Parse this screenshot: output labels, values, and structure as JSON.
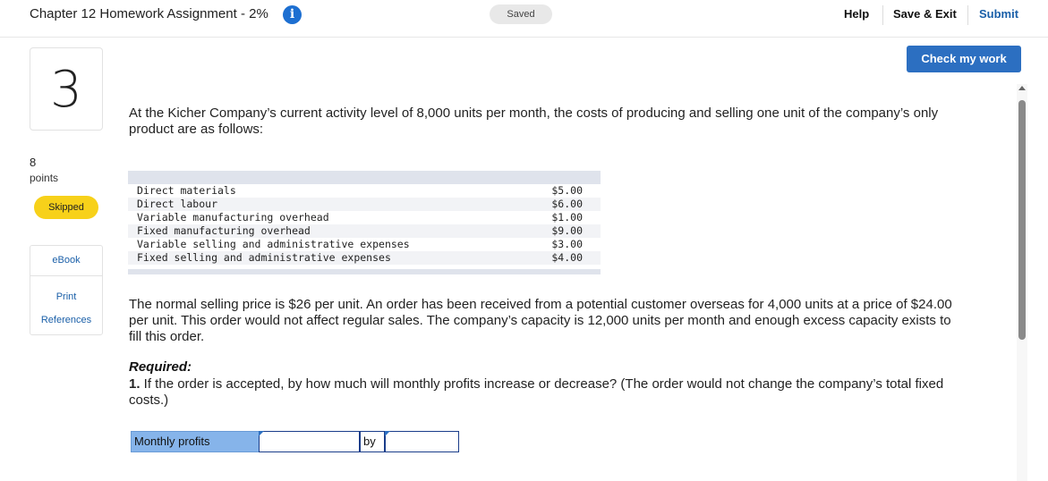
{
  "header": {
    "title": "Chapter 12 Homework Assignment - 2%",
    "info_icon": "info-icon",
    "saved_status": "Saved",
    "help_label": "Help",
    "save_exit_label": "Save & Exit",
    "submit_label": "Submit"
  },
  "question": {
    "number": "3",
    "points_value": "8",
    "points_label": "points",
    "status": "Skipped",
    "check_button": "Check my work",
    "intro": "At the Kicher Company’s current activity level of 8,000 units per month, the costs of producing and selling one unit of the company’s only product are as follows:",
    "details": "The normal selling price is $26 per unit. An order has been received from a potential customer overseas for 4,000 units at a price of $24.00 per unit. This order would not affect regular sales. The company’s capacity is 12,000 units per month and enough excess capacity exists to fill this order.",
    "required_heading": "Required:",
    "required_number": "1.",
    "required_text": " If the order is accepted, by how much will monthly profits increase or decrease? (The order would not change the company’s total fixed costs.)"
  },
  "side_links": {
    "ebook": "eBook",
    "print": "Print",
    "references": "References"
  },
  "cost_table": {
    "rows": [
      {
        "label": "Direct materials",
        "value": "$5.00"
      },
      {
        "label": "Direct labour",
        "value": "$6.00"
      },
      {
        "label": "Variable manufacturing overhead",
        "value": "$1.00"
      },
      {
        "label": "Fixed manufacturing overhead",
        "value": "$9.00"
      },
      {
        "label": "Variable selling and administrative expenses",
        "value": "$3.00"
      },
      {
        "label": "Fixed selling and administrative expenses",
        "value": "$4.00"
      }
    ]
  },
  "answer": {
    "label": "Monthly profits",
    "select_value": "",
    "by_label": "by",
    "amount_value": ""
  },
  "colors": {
    "accent": "#2c6fc1",
    "skipped": "#f7d11a",
    "answer_label_bg": "#86b4ea"
  }
}
